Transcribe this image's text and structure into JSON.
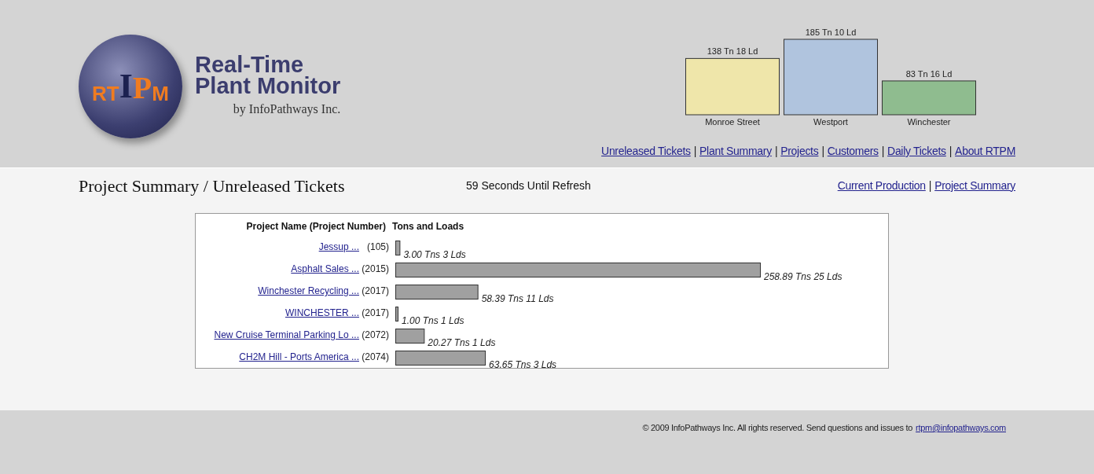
{
  "brand": {
    "logo_letters": [
      "RT",
      "I",
      "P",
      "M"
    ],
    "title_line_1": "Real-Time",
    "title_line_2": "Plant Monitor",
    "byline": "by InfoPathways Inc."
  },
  "plants": [
    {
      "name": "Monroe Street",
      "color": "#efe6aa",
      "reading": "138 Tn 18 Ld"
    },
    {
      "name": "Westport",
      "color": "#b0c4de",
      "reading": "185 Tn 10 Ld"
    },
    {
      "name": "Winchester",
      "color": "#8fbc8f",
      "reading": "83 Tn 16 Ld"
    }
  ],
  "separator": "|",
  "nav": [
    "Unreleased Tickets",
    "Plant Summary",
    "Projects",
    "Customers",
    "Daily Tickets",
    "About RTPM"
  ],
  "page_title": "Project Summary / Unreleased Tickets",
  "refresh": {
    "count": "59",
    "text": "Seconds Until Refresh"
  },
  "sub_nav": [
    "Current Production",
    "Project Summary"
  ],
  "table": {
    "columns": [
      "Project Name (Project Number)",
      "Tons and Loads"
    ],
    "rows": [
      {
        "name": "Jessup ...",
        "number": "(105)",
        "reading": "3.00 Tns 3 Lds"
      },
      {
        "name": "Asphalt Sales ...",
        "number": "(2015)",
        "reading": "258.89 Tns 25 Lds"
      },
      {
        "name": "Winchester Recycling ...",
        "number": "(2017)",
        "reading": "58.39 Tns 11 Lds"
      },
      {
        "name": "WINCHESTER ...",
        "number": "(2017)",
        "reading": "1.00 Tns 1 Lds"
      },
      {
        "name": "New Cruise Terminal Parking Lo ...",
        "number": "(2072)",
        "reading": "20.27 Tns 1 Lds"
      },
      {
        "name": "CH2M Hill - Ports America ...",
        "number": "(2074)",
        "reading": "63.65 Tns 3 Lds"
      }
    ]
  },
  "footer": {
    "text": "© 2009 InfoPathways Inc. All rights reserved. Send questions and issues to",
    "email": "rtpm@infopathways.com"
  }
}
